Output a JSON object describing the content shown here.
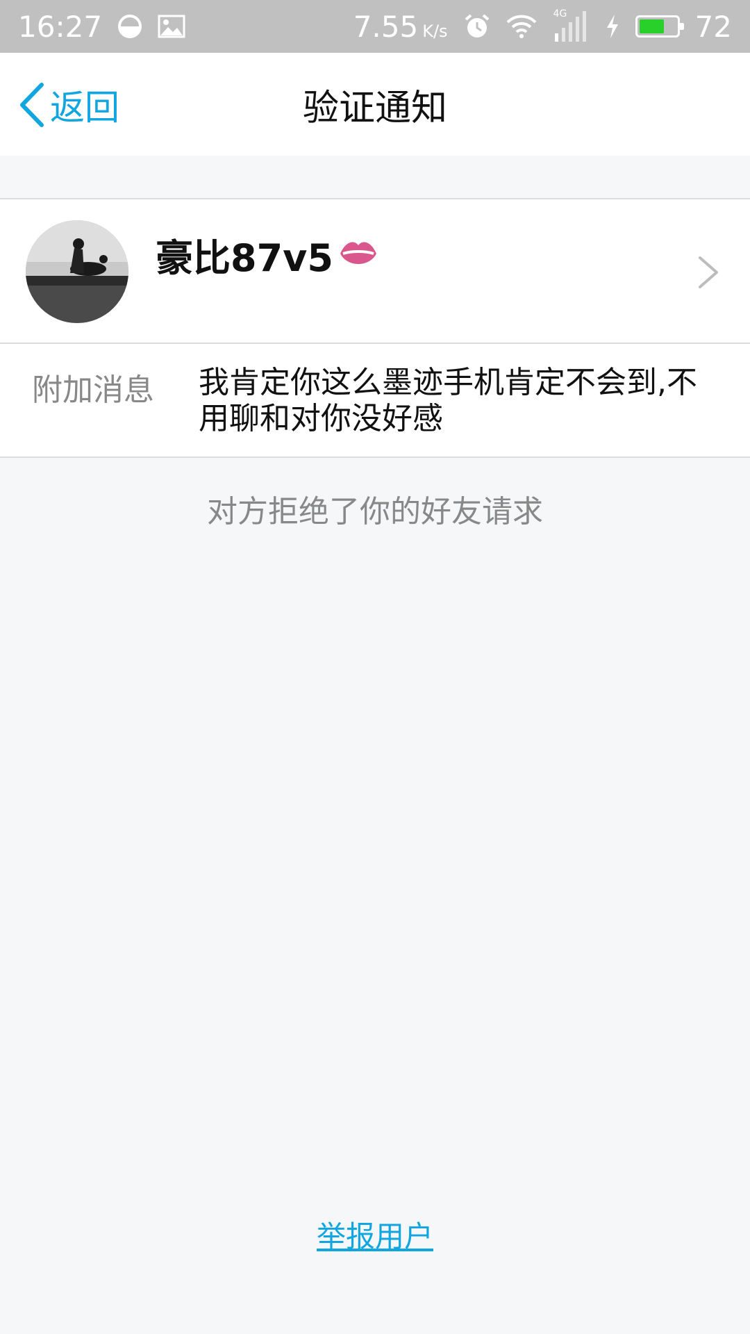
{
  "status_bar": {
    "time": "16:27",
    "speed_value": "7.55",
    "speed_unit": "K/s",
    "network_type": "4G",
    "battery_level": "72",
    "battery_percent": 72,
    "battery_color": "#2ad02a",
    "icons": [
      "data-saver-icon",
      "image-icon",
      "alarm-icon",
      "wifi-icon",
      "signal-icon",
      "charging-icon",
      "battery-icon"
    ]
  },
  "navbar": {
    "back_label": "返回",
    "title": "验证通知",
    "accent_color": "#12a6e0"
  },
  "profile": {
    "username": "豪比87v5",
    "badge_icon": "lips-icon",
    "badge_color": "#d9578c"
  },
  "message": {
    "label": "附加消息",
    "text": "我肯定你这么墨迹手机肯定不会到,不用聊和对你没好感"
  },
  "status": {
    "text": "对方拒绝了你的好友请求"
  },
  "report": {
    "label": "举报用户"
  }
}
